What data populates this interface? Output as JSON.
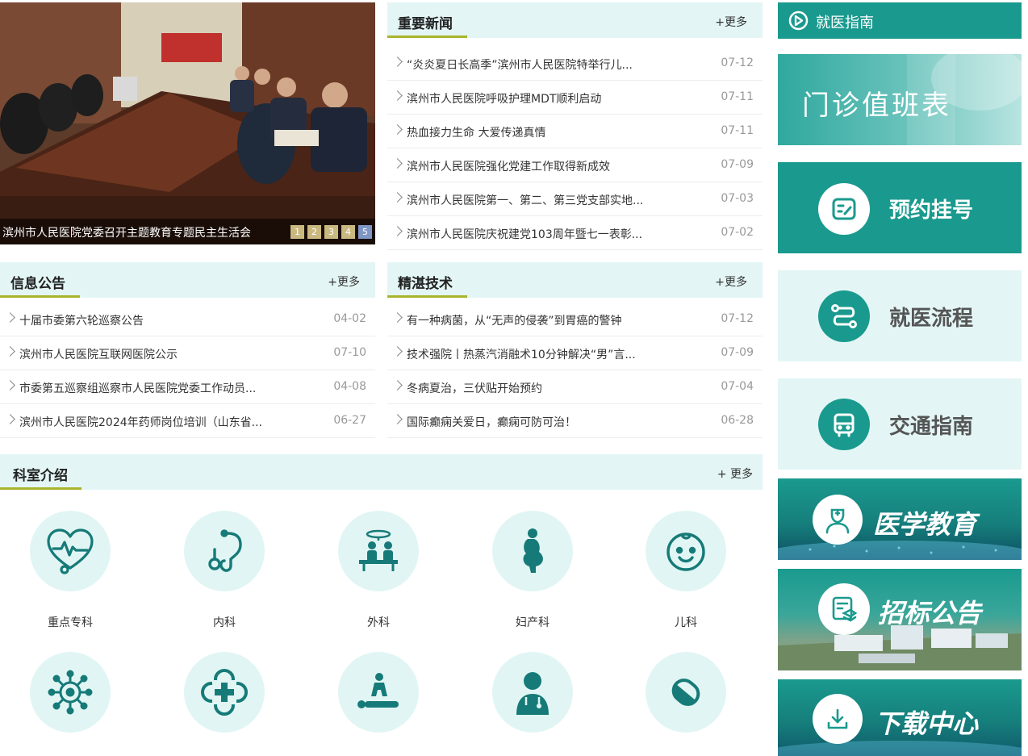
{
  "slider": {
    "caption": "滨州市人民医院党委召开主题教育专题民主生活会",
    "dots": [
      "1",
      "2",
      "3",
      "4",
      "5"
    ],
    "active_dot": 4
  },
  "panels": {
    "important_news": {
      "title": "重要新闻",
      "more": "+更多",
      "items": [
        {
          "title": "“炎炎夏日长高季”滨州市人民医院特举行儿...",
          "date": "07-12"
        },
        {
          "title": "滨州市人民医院呼吸护理MDT顺利启动",
          "date": "07-11"
        },
        {
          "title": "热血接力生命 大爱传递真情",
          "date": "07-11"
        },
        {
          "title": "滨州市人民医院强化党建工作取得新成效",
          "date": "07-09"
        },
        {
          "title": "滨州市人民医院第一、第二、第三党支部实地...",
          "date": "07-03"
        },
        {
          "title": "滨州市人民医院庆祝建党103周年暨七一表彰...",
          "date": "07-02"
        }
      ]
    },
    "announcements": {
      "title": "信息公告",
      "more": "+更多",
      "items": [
        {
          "title": "十届市委第六轮巡察公告",
          "date": "04-02"
        },
        {
          "title": "滨州市人民医院互联网医院公示",
          "date": "07-10"
        },
        {
          "title": "市委第五巡察组巡察市人民医院党委工作动员...",
          "date": "04-08"
        },
        {
          "title": "滨州市人民医院2024年药师岗位培训（山东省...",
          "date": "06-27"
        }
      ]
    },
    "techniques": {
      "title": "精湛技术",
      "more": "+更多",
      "items": [
        {
          "title": "有一种病菌，从“无声的侵袭”到胃癌的警钟",
          "date": "07-12"
        },
        {
          "title": "技术强院丨热蒸汽消融术10分钟解决“男”言...",
          "date": "07-09"
        },
        {
          "title": "冬病夏治，三伏贴开始预约",
          "date": "07-04"
        },
        {
          "title": "国际癫痫关爱日，癫痫可防可治！",
          "date": "06-28"
        }
      ]
    }
  },
  "departments": {
    "title": "科室介绍",
    "more": "+ 更多",
    "items": [
      {
        "label": "重点专科",
        "icon": "heart-pulse-icon"
      },
      {
        "label": "内科",
        "icon": "stethoscope-icon"
      },
      {
        "label": "外科",
        "icon": "surgery-icon"
      },
      {
        "label": "妇产科",
        "icon": "pregnant-icon"
      },
      {
        "label": "儿科",
        "icon": "baby-face-icon"
      },
      {
        "label": "",
        "icon": "virus-icon"
      },
      {
        "label": "",
        "icon": "medical-cross-icon"
      },
      {
        "label": "",
        "icon": "cpr-icon"
      },
      {
        "label": "",
        "icon": "doctor-icon"
      },
      {
        "label": "",
        "icon": "pill-icon"
      }
    ]
  },
  "sidebar": {
    "guide_title": "就医指南",
    "schedule": "门诊值班表",
    "appointment": "预约挂号",
    "process": "就医流程",
    "traffic": "交通指南",
    "education": "医学教育",
    "bidding": "招标公告",
    "download": "下载中心"
  },
  "colors": {
    "teal": "#1a9a8e",
    "light_teal": "#e3f6f5",
    "accent_underline": "#a8b42c",
    "icon_teal": "#167a78"
  }
}
